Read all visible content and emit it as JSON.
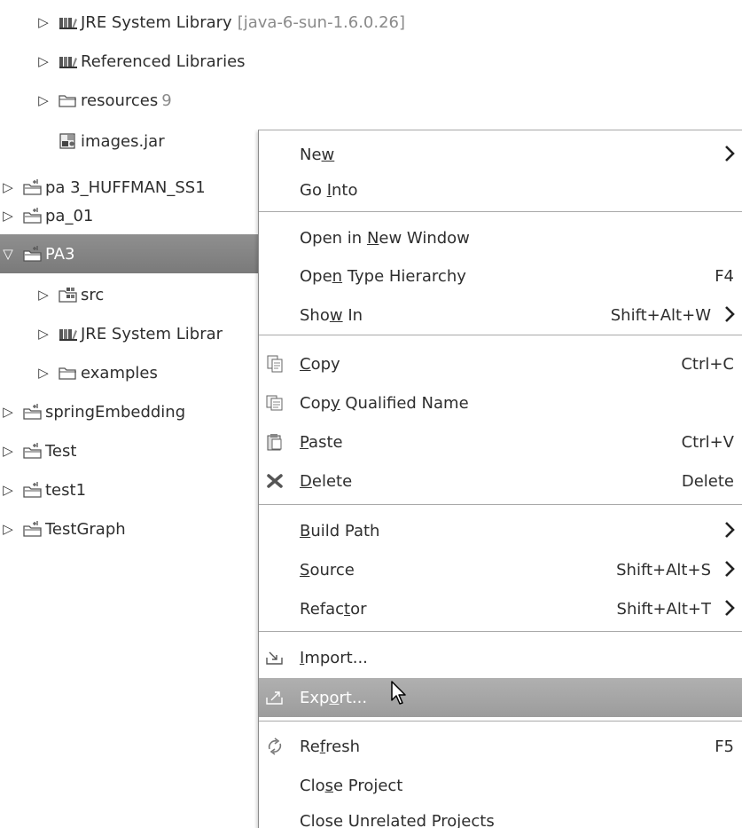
{
  "tree": {
    "jre_lib_top": {
      "label": "JRE System Library",
      "decoration": "[java-6-sun-1.6.0.26]",
      "icon": "library-icon"
    },
    "ref_libs": {
      "label": "Referenced Libraries",
      "icon": "library-icon"
    },
    "resources": {
      "label": "resources",
      "count": "9",
      "icon": "folder-icon"
    },
    "images_jar": {
      "label": "images.jar",
      "icon": "jar-icon"
    },
    "pa3_huffman": {
      "label": "pa 3_HUFFMAN_SS1",
      "icon": "project-icon"
    },
    "pa_01": {
      "label": "pa_01",
      "icon": "project-icon"
    },
    "pa3": {
      "label": "PA3",
      "icon": "project-icon"
    },
    "src": {
      "label": "src",
      "icon": "package-folder-icon"
    },
    "jre_lib_pa3": {
      "label": "JRE System Librar",
      "icon": "library-icon"
    },
    "examples": {
      "label": "examples",
      "icon": "folder-icon"
    },
    "spring": {
      "label": "springEmbedding",
      "icon": "project-icon"
    },
    "test": {
      "label": "Test",
      "icon": "project-icon"
    },
    "test1": {
      "label": "test1",
      "icon": "project-icon"
    },
    "testgraph": {
      "label": "TestGraph",
      "icon": "project-icon"
    }
  },
  "menu": {
    "new": {
      "pre": "Ne",
      "mn": "w",
      "post": ""
    },
    "go_into": {
      "pre": "Go ",
      "mn": "I",
      "post": "nto"
    },
    "open_new_window": {
      "pre": "Open in ",
      "mn": "N",
      "post": "ew Window"
    },
    "open_type_hierarchy": {
      "pre": "Ope",
      "mn": "n",
      "post": " Type Hierarchy",
      "shortcut": "F4"
    },
    "show_in": {
      "pre": "Sho",
      "mn": "w",
      "post": " In",
      "shortcut": "Shift+Alt+W"
    },
    "copy": {
      "pre": "",
      "mn": "C",
      "post": "opy",
      "shortcut": "Ctrl+C"
    },
    "copy_qualified": {
      "pre": "Cop",
      "mn": "y",
      "post": " Qualified Name"
    },
    "paste": {
      "pre": "",
      "mn": "P",
      "post": "aste",
      "shortcut": "Ctrl+V"
    },
    "delete": {
      "pre": "",
      "mn": "D",
      "post": "elete",
      "shortcut": "Delete"
    },
    "build_path": {
      "pre": "",
      "mn": "B",
      "post": "uild Path"
    },
    "source": {
      "pre": "",
      "mn": "S",
      "post": "ource",
      "shortcut": "Shift+Alt+S"
    },
    "refactor": {
      "pre": "Refac",
      "mn": "t",
      "post": "or",
      "shortcut": "Shift+Alt+T"
    },
    "import": {
      "pre": "",
      "mn": "I",
      "post": "mport..."
    },
    "export": {
      "pre": "Exp",
      "mn": "o",
      "post": "rt..."
    },
    "refresh": {
      "pre": "Re",
      "mn": "f",
      "post": "resh",
      "shortcut": "F5"
    },
    "close_project": {
      "pre": "Clo",
      "mn": "s",
      "post": "e Project"
    },
    "close_unrelated": {
      "pre": "Close Unrelated Projects",
      "mn": "",
      "post": ""
    }
  },
  "colors": {
    "selection": "#868686",
    "menu_highlight": "#a6a6a6",
    "separator": "#a9a9a9"
  }
}
